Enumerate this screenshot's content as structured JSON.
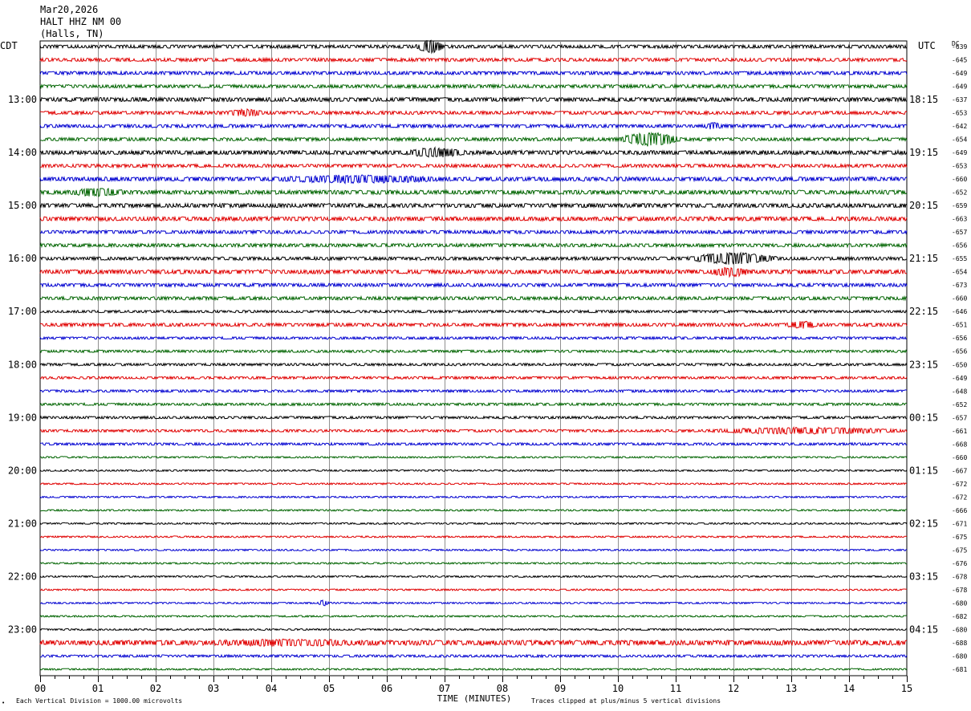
{
  "header": {
    "date": "Mar20,2026",
    "station": "HALT HHZ NM 00",
    "location": "(Halls, TN)"
  },
  "left_axis_label": "CDT",
  "right_axis_label": "UTC",
  "dc_label": "DC",
  "footer": {
    "scale_note": "Each Vertical Division = 1000.00 microvolts",
    "clip_note": "Traces clipped at plus/minus 5 vertical divisions",
    "xlabel": "TIME (MINUTES)",
    "mark": "•"
  },
  "chart_data": {
    "type": "line",
    "title": "",
    "xlabel": "TIME (MINUTES)",
    "ylabel": "",
    "xlim": [
      0,
      15
    ],
    "x_ticks": [
      "00",
      "01",
      "02",
      "03",
      "04",
      "05",
      "06",
      "07",
      "08",
      "09",
      "10",
      "11",
      "12",
      "13",
      "14",
      "15"
    ],
    "grid": true,
    "trace_colors": [
      "#000000",
      "#e00000",
      "#0000d0",
      "#006400"
    ],
    "cdt_labels": [
      {
        "row": 4,
        "label": "13:00"
      },
      {
        "row": 8,
        "label": "14:00"
      },
      {
        "row": 12,
        "label": "15:00"
      },
      {
        "row": 16,
        "label": "16:00"
      },
      {
        "row": 20,
        "label": "17:00"
      },
      {
        "row": 24,
        "label": "18:00"
      },
      {
        "row": 28,
        "label": "19:00"
      },
      {
        "row": 32,
        "label": "20:00"
      },
      {
        "row": 36,
        "label": "21:00"
      },
      {
        "row": 40,
        "label": "22:00"
      },
      {
        "row": 44,
        "label": "23:00"
      }
    ],
    "utc_labels": [
      {
        "row": 4,
        "label": "18:15"
      },
      {
        "row": 8,
        "label": "19:15"
      },
      {
        "row": 12,
        "label": "20:15"
      },
      {
        "row": 16,
        "label": "21:15"
      },
      {
        "row": 20,
        "label": "22:15"
      },
      {
        "row": 24,
        "label": "23:15"
      },
      {
        "row": 28,
        "label": "00:15"
      },
      {
        "row": 32,
        "label": "01:15"
      },
      {
        "row": 36,
        "label": "02:15"
      },
      {
        "row": 40,
        "label": "03:15"
      },
      {
        "row": 44,
        "label": "04:15"
      }
    ],
    "dc_offsets": [
      "-639",
      "-645",
      "-649",
      "-649",
      "-637",
      "-653",
      "-642",
      "-654",
      "-649",
      "-653",
      "-660",
      "-652",
      "-659",
      "-663",
      "-657",
      "-656",
      "-655",
      "-654",
      "-673",
      "-660",
      "-646",
      "-651",
      "-656",
      "-656",
      "-650",
      "-649",
      "-648",
      "-652",
      "-657",
      "-661",
      "-668",
      "-660",
      "-667",
      "-672",
      "-672",
      "-666",
      "-671",
      "-675",
      "-675",
      "-676",
      "-678",
      "-678",
      "-680",
      "-682",
      "-680",
      "-688",
      "-680",
      "-681"
    ],
    "noise": [
      2,
      2,
      2,
      2,
      2.5,
      2,
      2,
      2,
      2.5,
      2,
      2.5,
      2.5,
      2.5,
      2.5,
      2,
      2,
      2,
      2.5,
      2,
      2,
      1.5,
      2,
      1.5,
      1.5,
      1.5,
      1.5,
      1.5,
      1.5,
      1.5,
      1.5,
      1.5,
      1,
      1,
      1,
      1,
      1,
      1,
      1,
      1,
      1,
      1,
      1,
      1,
      1,
      1,
      3,
      1.5,
      1
    ],
    "events": [
      {
        "row": 0,
        "start": 6.5,
        "end": 7.0,
        "amp": 7
      },
      {
        "row": 5,
        "start": 3.2,
        "end": 3.9,
        "amp": 3
      },
      {
        "row": 6,
        "start": 11.5,
        "end": 11.8,
        "amp": 3
      },
      {
        "row": 7,
        "start": 10.0,
        "end": 11.1,
        "amp": 7
      },
      {
        "row": 8,
        "start": 6.3,
        "end": 7.4,
        "amp": 4
      },
      {
        "row": 10,
        "start": 4.0,
        "end": 7.0,
        "amp": 3
      },
      {
        "row": 11,
        "start": 0.5,
        "end": 1.5,
        "amp": 3
      },
      {
        "row": 16,
        "start": 11.2,
        "end": 12.8,
        "amp": 6
      },
      {
        "row": 17,
        "start": 11.6,
        "end": 12.3,
        "amp": 4
      },
      {
        "row": 21,
        "start": 12.9,
        "end": 13.5,
        "amp": 3
      },
      {
        "row": 29,
        "start": 11.5,
        "end": 15.0,
        "amp": 3
      },
      {
        "row": 42,
        "start": 4.8,
        "end": 5.0,
        "amp": 3
      },
      {
        "row": 45,
        "start": 3.0,
        "end": 5.5,
        "amp": 2
      }
    ]
  }
}
